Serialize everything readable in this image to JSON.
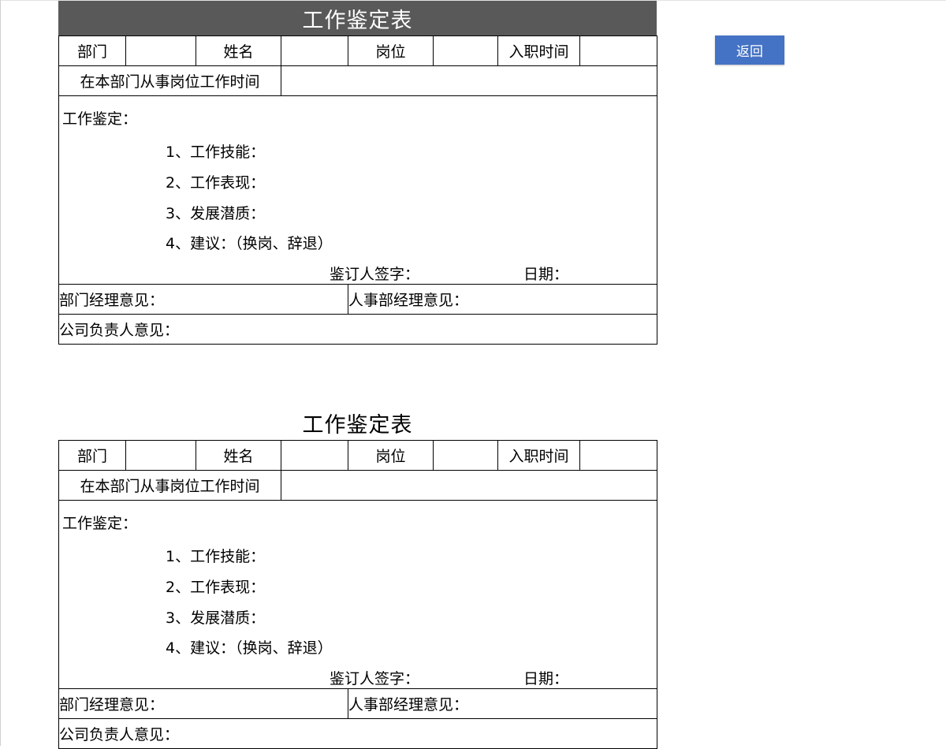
{
  "return_button": "返回",
  "forms": [
    {
      "title": "工作鉴定表",
      "header_labels": [
        "部门",
        "姓名",
        "岗位",
        "入职时间"
      ],
      "tenure_label": "在本部门从事岗位工作时间",
      "evaluation_title": "工作鉴定：",
      "evaluation_items": [
        "1、工作技能：",
        "2、工作表现：",
        "3、发展潜质：",
        "4、建议：（换岗、辞退）"
      ],
      "signature_label": "鉴订人签字：",
      "date_label": "日期：",
      "dept_manager_opinion": "部门经理意见：",
      "hr_manager_opinion": "人事部经理意见：",
      "company_head_opinion": "公司负责人意见："
    },
    {
      "title": "工作鉴定表",
      "header_labels": [
        "部门",
        "姓名",
        "岗位",
        "入职时间"
      ],
      "tenure_label": "在本部门从事岗位工作时间",
      "evaluation_title": "工作鉴定：",
      "evaluation_items": [
        "1、工作技能：",
        "2、工作表现：",
        "3、发展潜质：",
        "4、建议：（换岗、辞退）"
      ],
      "signature_label": "鉴订人签字：",
      "date_label": "日期：",
      "dept_manager_opinion": "部门经理意见：",
      "hr_manager_opinion": "人事部经理意见：",
      "company_head_opinion": "公司负责人意见："
    }
  ],
  "colors": {
    "title_bar": "#595959",
    "button": "#4472c4"
  }
}
